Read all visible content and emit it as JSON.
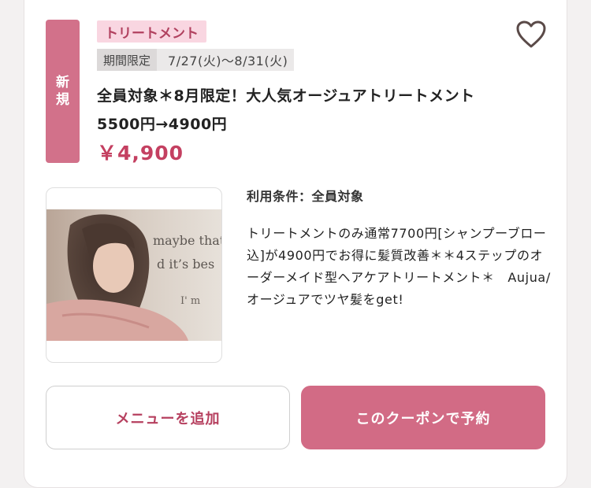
{
  "coupon": {
    "new_badge": "新規",
    "category_tag": "トリートメント",
    "period_label": "期間限定",
    "period_dates": "7/27(火)〜8/31(火)",
    "title": "全員対象＊8月限定！大人気オージュアトリートメント　5500円→4900円",
    "price": "￥4,900",
    "condition": "利用条件：全員対象",
    "description": "トリートメントのみ通常7700円[シャンプーブロー込]が4900円でお得に髪質改善＊＊4ステップのオーダーメイド型ヘアケアトリートメント＊　Aujua/オージュアでツヤ髪をget!",
    "photo_text_1": "maybe that'",
    "photo_text_2": "d it’s bes",
    "photo_text_3": "I' m"
  },
  "buttons": {
    "add_menu": "メニューを追加",
    "reserve": "このクーポンで予約"
  },
  "colors": {
    "accent": "#d26b85",
    "price": "#c44061",
    "tag_bg": "#f9d6e1"
  },
  "icons": {
    "favorite": "heart-icon"
  }
}
